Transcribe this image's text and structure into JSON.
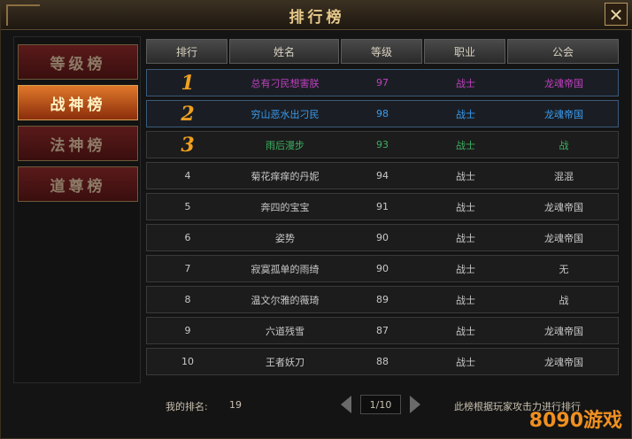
{
  "window": {
    "title": "排行榜",
    "close_label": "✕"
  },
  "tabs": [
    {
      "label": "等级榜"
    },
    {
      "label": "战神榜"
    },
    {
      "label": "法神榜"
    },
    {
      "label": "道尊榜"
    }
  ],
  "table": {
    "headers": [
      "排行",
      "姓名",
      "等级",
      "职业",
      "公会"
    ],
    "rows": [
      {
        "rank": "1",
        "name": "总有刁民想害朕",
        "level": "97",
        "class": "战士",
        "guild": "龙魂帝国",
        "color": "#c040c0"
      },
      {
        "rank": "2",
        "name": "穷山恶水出刁民",
        "level": "98",
        "class": "战士",
        "guild": "龙魂帝国",
        "color": "#3a9cf0"
      },
      {
        "rank": "3",
        "name": "雨后漫步",
        "level": "93",
        "class": "战士",
        "guild": "战",
        "color": "#3cb060"
      },
      {
        "rank": "4",
        "name": "菊花痒痒的丹妮",
        "level": "94",
        "class": "战士",
        "guild": "混混",
        "color": "#c8c8c8"
      },
      {
        "rank": "5",
        "name": "奔四的宝宝",
        "level": "91",
        "class": "战士",
        "guild": "龙魂帝国",
        "color": "#c8c8c8"
      },
      {
        "rank": "6",
        "name": "姿势",
        "level": "90",
        "class": "战士",
        "guild": "龙魂帝国",
        "color": "#c8c8c8"
      },
      {
        "rank": "7",
        "name": "寂寞孤单的雨绮",
        "level": "90",
        "class": "战士",
        "guild": "无",
        "color": "#c8c8c8"
      },
      {
        "rank": "8",
        "name": "温文尔雅的薇琦",
        "level": "89",
        "class": "战士",
        "guild": "战",
        "color": "#c8c8c8"
      },
      {
        "rank": "9",
        "name": "六道残雪",
        "level": "87",
        "class": "战士",
        "guild": "龙魂帝国",
        "color": "#c8c8c8"
      },
      {
        "rank": "10",
        "name": "王者妖刀",
        "level": "88",
        "class": "战士",
        "guild": "龙魂帝国",
        "color": "#c8c8c8"
      }
    ]
  },
  "footer": {
    "my_rank_label": "我的排名:",
    "my_rank_value": "19",
    "page": "1/10",
    "note": "此榜根据玩家攻击力进行排行"
  },
  "watermark": "8090游戏"
}
